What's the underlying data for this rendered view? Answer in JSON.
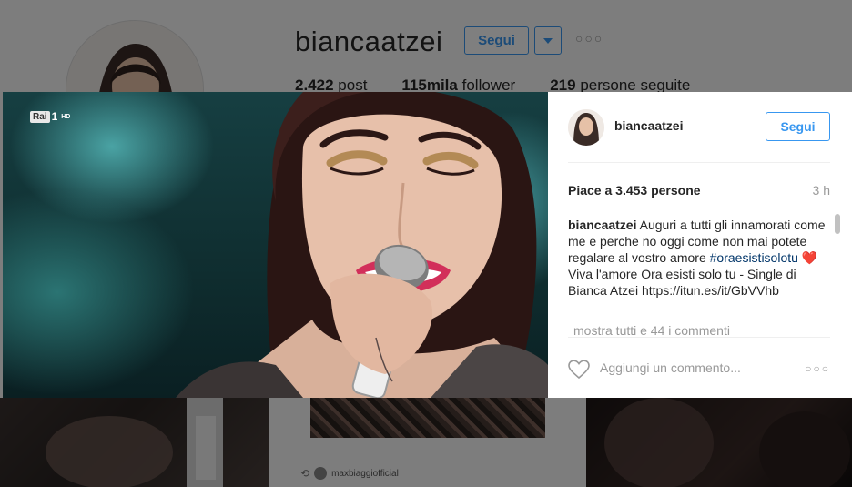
{
  "profile": {
    "username": "biancaatzei",
    "follow_label": "Segui",
    "more": "○○○",
    "stats": [
      {
        "value": "2.422",
        "label": "post"
      },
      {
        "value": "115mila",
        "label": "follower"
      },
      {
        "value": "219",
        "label": "persone seguite"
      }
    ]
  },
  "grid": {
    "repost_user": "maxbiaggiofficial"
  },
  "modal": {
    "channel": {
      "box": "Rai",
      "num": "1",
      "hd": "HD"
    },
    "username": "biancaatzei",
    "follow_label": "Segui",
    "likes": "Piace a 3.453 persone",
    "time": "3 h",
    "caption": {
      "user": "biancaatzei",
      "text_part1": "Auguri a tutti gli innamorati come me e perche no oggi come non mai potete regalare al vostro amore",
      "hashtag": "#oraesistisolotu",
      "emoji": "❤️",
      "text_part2": "Viva l'amore Ora esisti solo tu - Single di Bianca Atzei https://itun.es/it/GbVVhb"
    },
    "view_all": "mostra tutti e 44 i commenti",
    "comment_placeholder": "Aggiungi un commento...",
    "more": "○○○"
  }
}
